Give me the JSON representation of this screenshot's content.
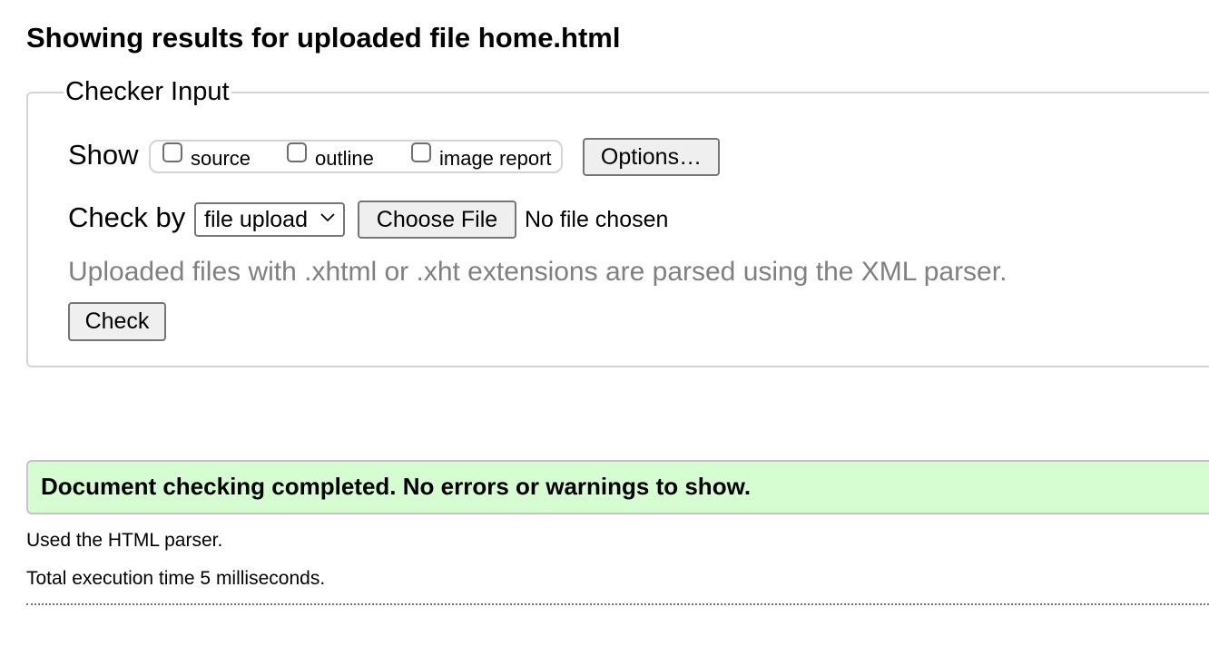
{
  "page": {
    "title": "Showing results for uploaded file home.html"
  },
  "checker_input": {
    "legend": "Checker Input",
    "show_label": "Show",
    "show_options": [
      {
        "label": "source",
        "checked": false
      },
      {
        "label": "outline",
        "checked": false
      },
      {
        "label": "image report",
        "checked": false
      }
    ],
    "options_button": "Options…",
    "check_by_label": "Check by",
    "check_by_selected": "file upload",
    "choose_file_button": "Choose File",
    "file_status": "No file chosen",
    "hint": "Uploaded files with .xhtml or .xht extensions are parsed using the XML parser.",
    "check_button": "Check"
  },
  "results": {
    "success_message": "Document checking completed. No errors or warnings to show.",
    "parser_info": "Used the HTML parser.",
    "execution_time": "Total execution time 5 milliseconds."
  },
  "colors": {
    "success_bg": "#d6fdd1",
    "hint_text": "#808080",
    "button_bg": "#efefef"
  }
}
